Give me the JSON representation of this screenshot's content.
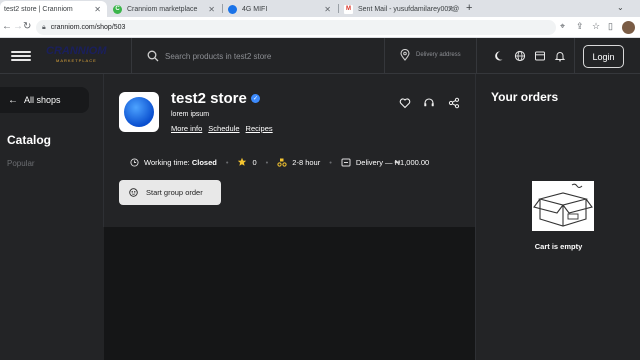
{
  "browser": {
    "tabs": [
      {
        "title": "test2 store | Cranniom",
        "active": true
      },
      {
        "title": "Cranniom marketplace",
        "active": false
      },
      {
        "title": "4G MIFI",
        "active": false
      },
      {
        "title": "Sent Mail - yusufdamilarey007@",
        "active": false
      }
    ],
    "new_tab": "+",
    "url": "cranniom.com/shop/503"
  },
  "header": {
    "logo_text": "CRANNIOM",
    "logo_sub": "MARKETPLACE",
    "search_placeholder": "Search products in test2 store",
    "delivery_placeholder": "Delivery address",
    "login_label": "Login"
  },
  "sidebar": {
    "back_label": "All shops",
    "catalog_title": "Catalog",
    "items": [
      {
        "label": "Popular"
      }
    ]
  },
  "shop": {
    "name": "test2 store",
    "description": "lorem ipsum",
    "links": [
      "More info",
      "Schedule",
      "Recipes"
    ],
    "working_time_label": "Working time:",
    "working_time_value": "Closed",
    "rating": "0",
    "delivery_time": "2-8 hour",
    "delivery_fee": "Delivery — ₦1,000.00",
    "group_order_label": "Start group order"
  },
  "orders": {
    "title": "Your orders",
    "empty_text": "Cart is empty"
  },
  "colors": {
    "background": "#232426",
    "accent_blue": "#3d8bfd",
    "star": "#f4c430"
  }
}
